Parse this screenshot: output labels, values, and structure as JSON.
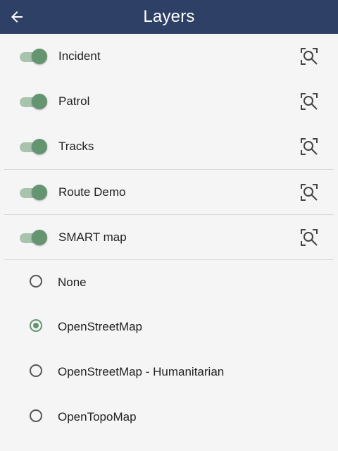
{
  "app": {
    "title": "Layers"
  },
  "layers": [
    {
      "label": "Incident",
      "enabled": true
    },
    {
      "label": "Patrol",
      "enabled": true
    },
    {
      "label": "Tracks",
      "enabled": true
    },
    {
      "label": "Route Demo",
      "enabled": true
    },
    {
      "label": "SMART map",
      "enabled": true
    }
  ],
  "basemaps": {
    "selected": "OpenStreetMap",
    "options": [
      "None",
      "OpenStreetMap",
      "OpenStreetMap - Humanitarian",
      "OpenTopoMap"
    ]
  },
  "colors": {
    "appbar": "#2e4066",
    "accent": "#659470",
    "toggle_track": "#a9c4ae"
  },
  "icons": {
    "back": "arrow-left-icon",
    "zoom": "zoom-to-layer-icon"
  }
}
